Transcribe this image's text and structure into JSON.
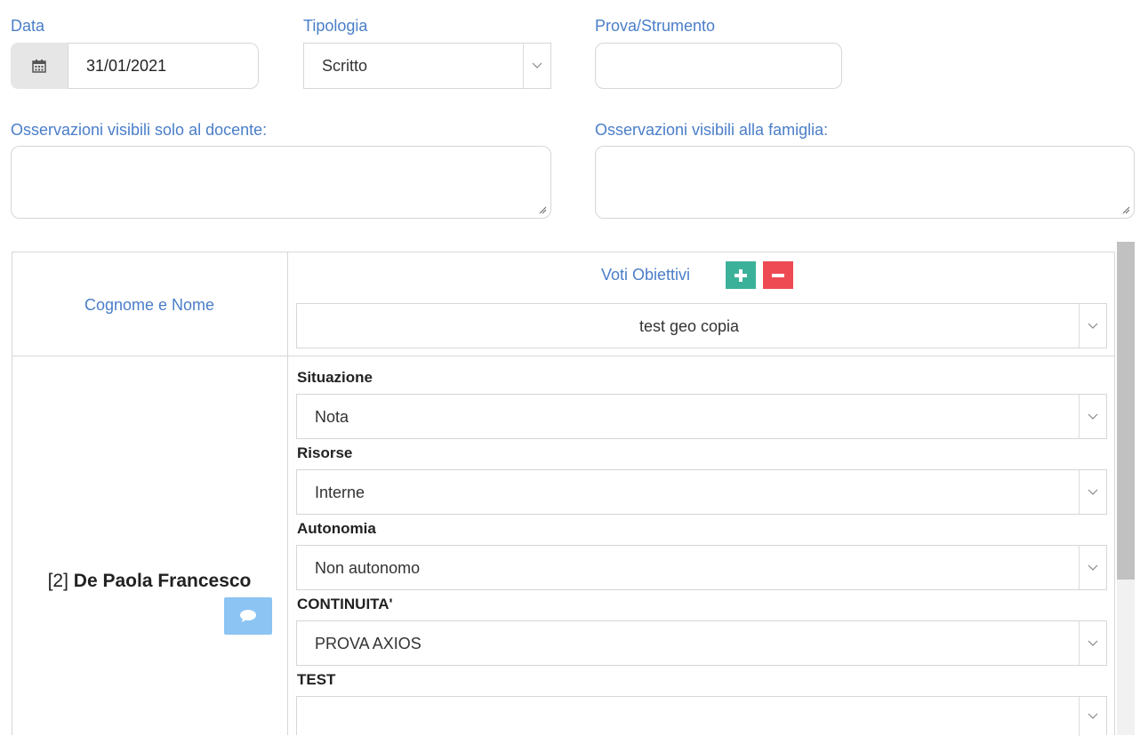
{
  "form": {
    "data_label": "Data",
    "date_value": "31/01/2021",
    "tipologia_label": "Tipologia",
    "tipologia_value": "Scritto",
    "prova_label": "Prova/Strumento",
    "prova_value": "",
    "obs_docente_label": "Osservazioni visibili solo al docente:",
    "obs_famiglia_label": "Osservazioni visibili alla famiglia:"
  },
  "table": {
    "name_header": "Cognome e Nome",
    "voti_header": "Voti Obiettivi",
    "objective_select": "test geo copia",
    "student": {
      "index": "[2]",
      "name": "De Paola Francesco"
    },
    "fields": [
      {
        "title": "Situazione",
        "value": "Nota"
      },
      {
        "title": "Risorse",
        "value": "Interne"
      },
      {
        "title": "Autonomia",
        "value": "Non autonomo"
      },
      {
        "title": "CONTINUITA'",
        "value": "PROVA AXIOS"
      },
      {
        "title": "TEST",
        "value": ""
      }
    ]
  },
  "colors": {
    "label_blue": "#4a7ec9",
    "add_green": "#3cb19a",
    "remove_red": "#ee4a53",
    "comment_blue": "#8cc4f3"
  },
  "icons": [
    "calendar-icon",
    "chevron-down-icon",
    "plus-icon",
    "minus-icon",
    "comment-icon"
  ]
}
